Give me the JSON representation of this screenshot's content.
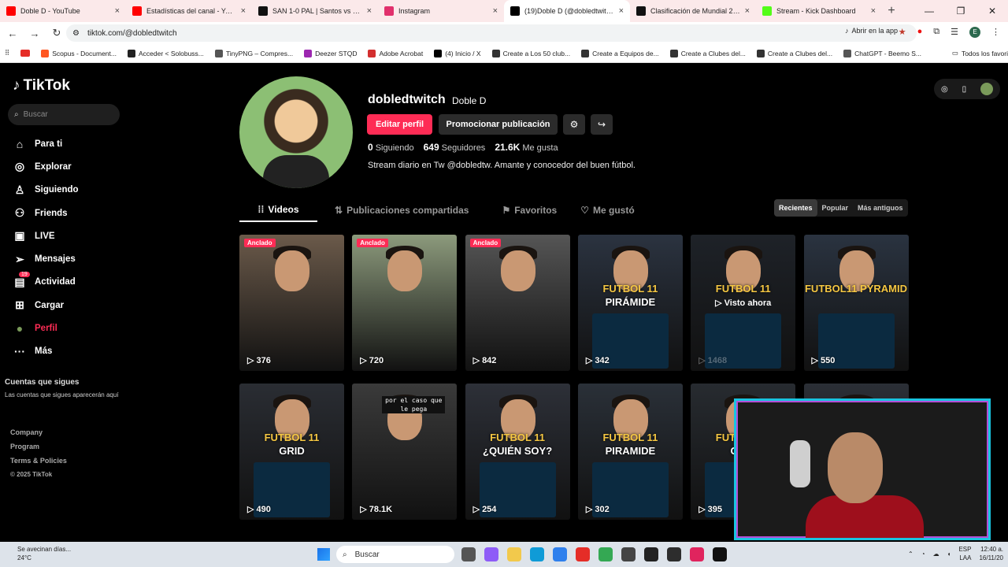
{
  "browser": {
    "tabs": [
      {
        "title": "Doble D - YouTube",
        "color": "#ff0000"
      },
      {
        "title": "Estadísticas del canal - YouTube",
        "color": "#ff0000"
      },
      {
        "title": "SAN 1-0 PAL | Santos vs Palmei...",
        "color": "#111111"
      },
      {
        "title": "Instagram",
        "color": "#e1306c"
      },
      {
        "title": "(19)Doble D (@dobledtwitch) |",
        "color": "#000000"
      },
      {
        "title": "Clasificación de Mundial 2026 ...",
        "color": "#111111"
      },
      {
        "title": "Stream - Kick Dashboard",
        "color": "#53fc18"
      }
    ],
    "url": "tiktok.com/@dobledtwitch",
    "open_in_app": "Abrir en la app",
    "profile_initial": "E",
    "bookmarks": [
      "Scopus - Document...",
      "Acceder < Solobuss...",
      "TinyPNG – Compres...",
      "Deezer STQD",
      "Adobe Acrobat",
      "(4) Inicio / X",
      "Create a Los 50 club...",
      "Create a Equipos de...",
      "Create a Clubes del...",
      "Create a Clubes del...",
      "ChatGPT - Beemo S..."
    ],
    "all_bookmarks": "Todos los favori"
  },
  "sidebar": {
    "logo": "TikTok",
    "search_placeholder": "Buscar",
    "nav": [
      "Para ti",
      "Explorar",
      "Siguiendo",
      "Friends",
      "LIVE",
      "Mensajes",
      "Actividad",
      "Cargar",
      "Perfil",
      "Más"
    ],
    "activity_badge": "19",
    "following_title": "Cuentas que sigues",
    "following_sub": "Las cuentas que sigues aparecerán aquí",
    "footer": [
      "Company",
      "Program",
      "Terms & Policies"
    ],
    "copyright": "© 2025 TikTok"
  },
  "profile": {
    "username": "dobledtwitch",
    "display_name": "Doble D",
    "edit_label": "Editar perfil",
    "promo_label": "Promocionar publicación",
    "following_count": "0",
    "following_label": "Siguiendo",
    "followers_count": "649",
    "followers_label": "Seguidores",
    "likes_count": "21.6K",
    "likes_label": "Me gusta",
    "bio": "Stream diario en Tw @dobledtw. Amante y conocedor del buen fútbol."
  },
  "tabs": [
    "Videos",
    "Publicaciones compartidas",
    "Favoritos",
    "Me gustó"
  ],
  "sort": [
    "Recientes",
    "Popular",
    "Más antiguos"
  ],
  "videos": [
    {
      "views": "376",
      "pinned": "Anclado",
      "title": "",
      "title2": "",
      "overlay": ""
    },
    {
      "views": "720",
      "pinned": "Anclado",
      "title": "",
      "title2": "",
      "overlay": ""
    },
    {
      "views": "842",
      "pinned": "Anclado",
      "title": "",
      "title2": "",
      "overlay": ""
    },
    {
      "views": "342",
      "pinned": "",
      "title": "FUTBOL 11",
      "title2": "PIRÁMIDE",
      "overlay": ""
    },
    {
      "views": "1468",
      "pinned": "",
      "title": "FUTBOL 11",
      "title2": "",
      "overlay": "Visto ahora"
    },
    {
      "views": "550",
      "pinned": "",
      "title": "FUTBOL11 PYRAMID",
      "title2": "",
      "overlay": ""
    },
    {
      "views": "490",
      "pinned": "",
      "title": "FUTBOL 11",
      "title2": "GRID",
      "overlay": ""
    },
    {
      "views": "78.1K",
      "pinned": "",
      "title": "",
      "title2": "",
      "overlay": "",
      "caption": "por el caso que le pega"
    },
    {
      "views": "254",
      "pinned": "",
      "title": "FUTBOL 11",
      "title2": "¿QUIÉN SOY?",
      "overlay": ""
    },
    {
      "views": "302",
      "pinned": "",
      "title": "FUTBOL 11",
      "title2": "PIRAMIDE",
      "overlay": ""
    },
    {
      "views": "395",
      "pinned": "",
      "title": "FUTBOL 11",
      "title2": "GRID",
      "overlay": ""
    },
    {
      "views": "",
      "pinned": "",
      "title": "",
      "title2": "",
      "overlay": ""
    }
  ],
  "taskbar": {
    "weather_line1": "Se avecinan días...",
    "weather_line2": "24°C",
    "search_label": "Buscar",
    "lang1": "ESP",
    "lang2": "LAA",
    "time": "12:40 a.",
    "date": "16/11/20"
  }
}
